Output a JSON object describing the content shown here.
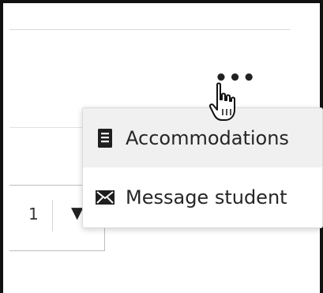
{
  "more_menu": {
    "button_label": "•••",
    "items": [
      {
        "label": "Accommodations",
        "icon": "document-list-icon"
      },
      {
        "label": "Message student",
        "icon": "envelope-icon"
      }
    ]
  },
  "pager": {
    "current_page": "1",
    "caret": "▼"
  },
  "colors": {
    "menu_hover_bg": "#f0f0f0",
    "frame": "#111111",
    "text": "#262626"
  }
}
